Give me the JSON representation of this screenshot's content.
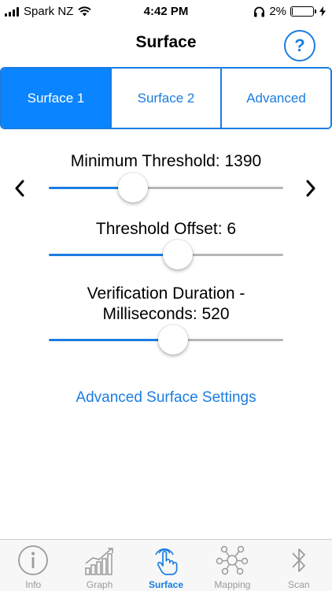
{
  "status_bar": {
    "carrier": "Spark NZ",
    "time": "4:42 PM",
    "battery_percent": "2%",
    "battery_level": 0.02,
    "icons": [
      "signal-icon",
      "wifi-icon",
      "headphones-icon",
      "battery-icon",
      "charging-icon"
    ]
  },
  "nav": {
    "title": "Surface",
    "help_label": "?"
  },
  "segments": {
    "items": [
      {
        "label": "Surface 1",
        "active": true
      },
      {
        "label": "Surface 2",
        "active": false
      },
      {
        "label": "Advanced",
        "active": false
      }
    ]
  },
  "sliders": [
    {
      "label": "Minimum Threshold: 1390",
      "level_percent": 36
    },
    {
      "label": "Threshold Offset: 6",
      "level_percent": 55
    },
    {
      "label_line1": "Verification Duration -",
      "label_line2": "Milliseconds: 520",
      "level_percent": 53
    }
  ],
  "advanced_link": "Advanced Surface Settings",
  "tabbar": {
    "items": [
      {
        "label": "Info",
        "icon": "info-icon",
        "active": false
      },
      {
        "label": "Graph",
        "icon": "graph-icon",
        "active": false
      },
      {
        "label": "Surface",
        "icon": "touch-icon",
        "active": true
      },
      {
        "label": "Mapping",
        "icon": "mapping-icon",
        "active": false
      },
      {
        "label": "Scan",
        "icon": "bluetooth-icon",
        "active": false
      }
    ]
  },
  "colors": {
    "accent": "#1a7de0",
    "segment_active": "#0a84ff",
    "track": "#b6b6b6",
    "tab_inactive": "#9a9a9a"
  }
}
